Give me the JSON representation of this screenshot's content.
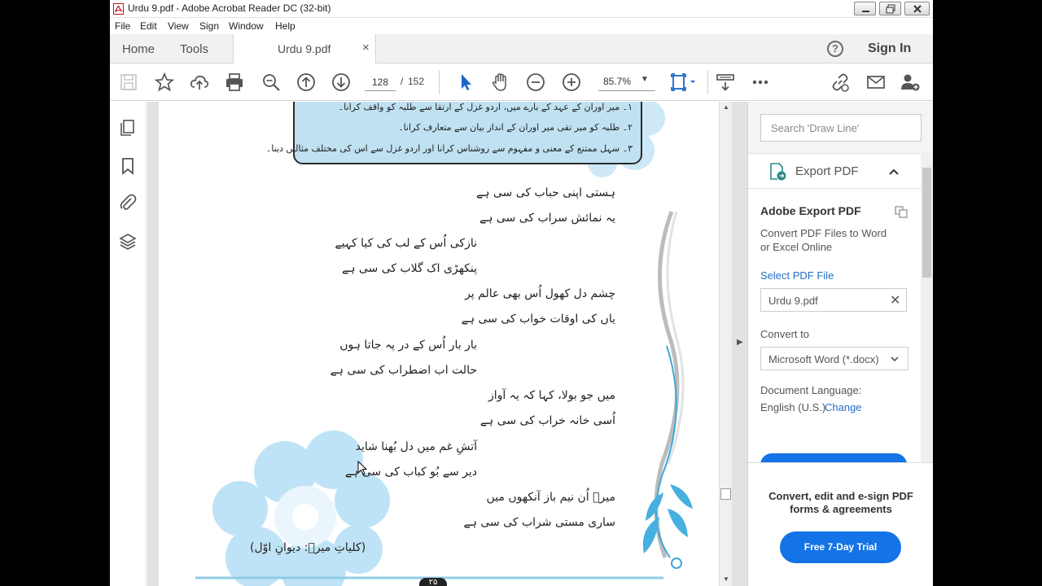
{
  "window": {
    "title": "Urdu 9.pdf - Adobe Acrobat Reader DC (32-bit)"
  },
  "menu": [
    "File",
    "Edit",
    "View",
    "Sign",
    "Window",
    "Help"
  ],
  "tabs": {
    "home": "Home",
    "tools": "Tools",
    "document": "Urdu 9.pdf",
    "close": "×",
    "help": "?",
    "signin": "Sign In"
  },
  "toolbar": {
    "page_current": "128",
    "page_sep": "/",
    "page_total": "152",
    "zoom": "85.7%",
    "icons": [
      "save-icon",
      "bookmark-star-icon",
      "upload-icon",
      "print-icon",
      "zoom-search-icon",
      "page-up-icon",
      "page-down-icon",
      "select-cursor-icon",
      "hand-icon",
      "zoom-out-icon",
      "zoom-in-icon",
      "fit-page-icon",
      "scroll-mode-icon",
      "more-icon",
      "share-link-icon",
      "email-icon",
      "add-user-icon"
    ]
  },
  "left_rail": {
    "icons": [
      "pages-icon",
      "bookmark-icon",
      "attachment-icon",
      "layers-icon"
    ]
  },
  "document": {
    "objectives": [
      "۱۔ میر اوران کے عہد کے بارے میں، اردو غزل کے ارتقا سے طلبہ کو واقف کرانا۔",
      "۲۔ طلبہ کو میر تقی میر اوران کے انداز بیان سے متعارف کرانا۔",
      "۳۔ سہل ممتنع کے معنی و مفہوم سے روشناس کرانا اور اردو غزل سے اس کی مختلف مثالیں دینا۔"
    ],
    "verses": [
      "ہستی اپنی حباب کی سی ہے",
      "یہ نمائش سراب کی سی ہے",
      "نازکی اُس کے لب کی کیا کہیے",
      "پنکھڑی اک گلاب کی سی ہے",
      "چشم دل کھول اُس بھی عالم پر",
      "یاں کی اوقات خواب کی سی ہے",
      "بار بار اُس کے در پہ جاتا ہوں",
      "حالت اب اضطراب کی سی ہے",
      "میں جو بولا، کہا کہ یہ آواز",
      "اُسی خانہ خراب کی سی ہے",
      "آتشِ غم میں دل بُھنا شاید",
      "دیر سے بُو کباب کی سی ہے",
      "میرؔ اُن نیم باز آنکھوں میں",
      "ساری مستی شراب کی سی ہے"
    ],
    "source": "(کلیاتِ میرؔ: دیوانِ اوّل)",
    "page_number": "۲۵"
  },
  "right_pane": {
    "search_placeholder": "Search 'Draw Line'",
    "export_header": "Export PDF",
    "panel_title": "Adobe Export PDF",
    "panel_desc": "Convert PDF Files to Word or Excel Online",
    "select_label": "Select PDF File",
    "file_name": "Urdu 9.pdf",
    "convert_label": "Convert to",
    "format": "Microsoft Word (*.docx)",
    "lang_label": "Document Language:",
    "lang_value": "English (U.S.)",
    "lang_change": "Change",
    "promo_text": "Convert, edit and e-sign PDF forms & agreements",
    "trial_button": "Free 7-Day Trial"
  },
  "colors": {
    "accent": "#1473e6",
    "objective_box": "#bfe1f2",
    "link": "#2470c8"
  }
}
